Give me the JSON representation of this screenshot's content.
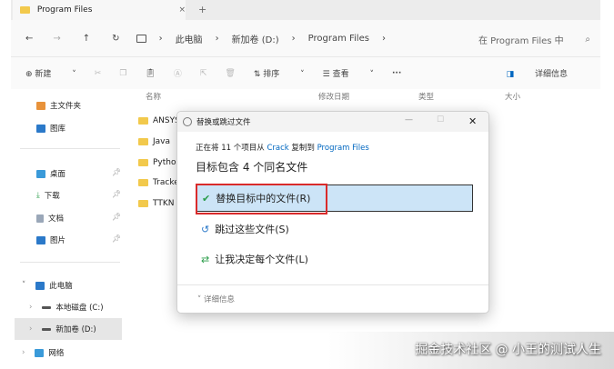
{
  "tab": {
    "title": "Program Files",
    "close": "×",
    "new": "+"
  },
  "nav": {
    "back": "←",
    "forward": "→",
    "up": "↑",
    "refresh": "↻"
  },
  "breadcrumb": [
    "此电脑",
    "新加卷 (D:)",
    "Program Files"
  ],
  "search": {
    "placeholder": "在 Program Files 中",
    "icon": "⌕"
  },
  "toolbar": {
    "new": "新建",
    "sort": "排序",
    "view": "查看",
    "more": "···",
    "details": "详细信息"
  },
  "columns": [
    "名称",
    "修改日期",
    "类型",
    "大小"
  ],
  "sidebar": {
    "home": "主文件夹",
    "gallery": "图库",
    "desktop": "桌面",
    "downloads": "下载",
    "documents": "文档",
    "pictures": "图片",
    "thispc": "此电脑",
    "cdrive": "本地磁盘 (C:)",
    "ddrive": "新加卷 (D:)",
    "network": "网络"
  },
  "files": [
    "ANSYS",
    "Java",
    "Pytho",
    "Tracke",
    "TTKN"
  ],
  "dialog": {
    "title": "替换或跳过文件",
    "line1_a": "正在将 11 个项目从 ",
    "src": "Crack",
    "line1_b": " 复制到 ",
    "dst": "Program Files",
    "heading": "目标包含 4 个同名文件",
    "opt_replace": "替换目标中的文件(R)",
    "opt_skip": "跳过这些文件(S)",
    "opt_decide": "让我决定每个文件(L)",
    "details": "详细信息",
    "minimize": "—",
    "maximize": "☐",
    "close": "✕"
  },
  "watermark": "掘金技术社区 @ 小王的测试人生",
  "colors": {
    "accent": "#0067c0",
    "selection": "#cce4f7",
    "highlight": "#d92b2b"
  }
}
